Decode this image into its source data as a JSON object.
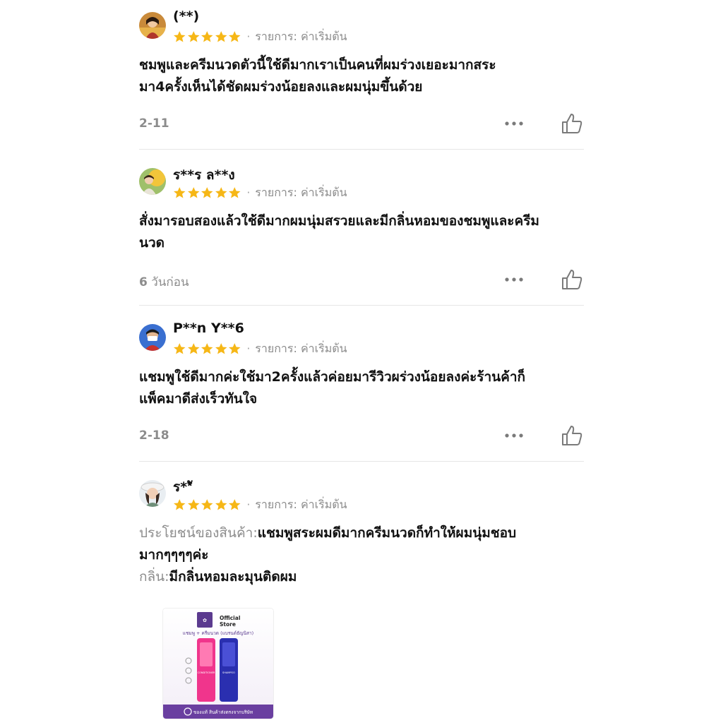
{
  "reviews": [
    {
      "username": "(**)",
      "rating": 5,
      "variant_label": "รายการ: ค่าเริ่มต้น",
      "body_lines": [
        "ชมพูและครีมนวดตัวนี้ใช้ดีมากเราเป็นคนที่ผมร่วงเยอะมากสระ",
        "มา4ครั้งเห็นได้ชัดผมร่วงน้อยลงและผมนุ่มขึ้นด้วย"
      ],
      "date": "2-11",
      "date_suffix": ""
    },
    {
      "username": "ร**ร ล**ง",
      "rating": 5,
      "variant_label": "รายการ: ค่าเริ่มต้น",
      "body_lines": [
        "สั่งมารอบสองแล้วใช้ดีมากผมนุ่มสรวยและมีกลิ่นหอมของชมพูและครีม",
        "นวด"
      ],
      "date": "6",
      "date_suffix": " วันก่อน"
    },
    {
      "username": "P**n Y**6",
      "rating": 5,
      "variant_label": "รายการ: ค่าเริ่มต้น",
      "body_lines": [
        "แชมพูใช้ดีมากค่ะใช้มา2ครั้งแล้วค่อยมารีวิวผร่วงน้อยลงค่ะร้านค้าก็",
        "แพ็คมาดีส่งเร็วทันใจ"
      ],
      "date": "2-18",
      "date_suffix": ""
    },
    {
      "username": "ร**ั",
      "rating": 5,
      "variant_label": "รายการ: ค่าเริ่มต้น",
      "body_prefix_1": "ประโยชน์ของสินค้า:",
      "body_line_1": "แชมพูสระผมดีมากครีมนวดก็ทำให้ผมนุ่มชอบ",
      "body_line_2": "มากๆๆๆๆค่ะ",
      "body_prefix_3": "กลิ่น:",
      "body_line_3": "มีกลิ่นหอมละมุนติดผม",
      "product_image": {
        "store_label": "Official Store",
        "title": "แชมพู + ครีมนวด (แบรนด์ธัญนิสา)",
        "bottle_left": "CONDITIONER",
        "bottle_right": "SHAMPOO",
        "footer": "ของแท้ สินค้าส่งตรงจากบริษัท"
      }
    }
  ],
  "colors": {
    "star": "#f6b716",
    "muted_text": "#8c8c8c",
    "divider": "#e6e6e6",
    "icon_gray": "#7a7a7a"
  },
  "icons": {
    "rating": "star-icon",
    "more": "more-options-icon",
    "like": "thumbs-up-icon"
  }
}
